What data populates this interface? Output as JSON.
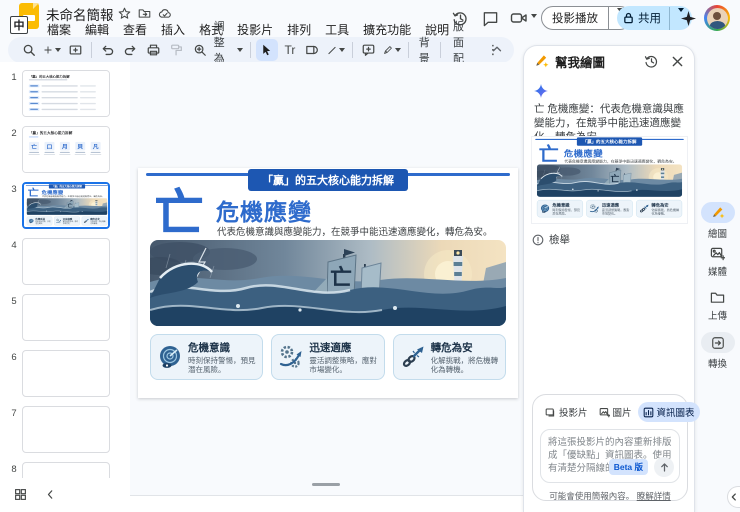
{
  "titlebar": {
    "logo_badge": "中",
    "doc_title": "未命名簡報",
    "menus": [
      "檔案",
      "編輯",
      "查看",
      "插入",
      "格式",
      "投影片",
      "排列",
      "工具",
      "擴充功能",
      "說明"
    ],
    "present_label": "投影播放",
    "share_label": "共用"
  },
  "toolbar": {
    "zoom_fit_label": "調整為符",
    "text_tool_label": "Tr",
    "background_label": "背景",
    "layout_label": "版面配置",
    "more_label": "⋮"
  },
  "filmstrip": {
    "numbers": [
      "1",
      "2",
      "3",
      "4",
      "5",
      "6",
      "7",
      "8"
    ],
    "slide1_title": "「贏」的五大核心能力拆解",
    "slide2_title": "「贏」的五大核心能力拆解",
    "slide2_chars": [
      "亡",
      "口",
      "月",
      "貝",
      "凡"
    ]
  },
  "slide": {
    "badge_title": "「贏」的五大核心能力拆解",
    "glyph": "亡",
    "heading": "危機應變",
    "subtitle": "代表危機意識與應變能力，在競爭中能迅速適應變化，轉危為安。",
    "sail_glyph": "亡",
    "cards": [
      {
        "title": "危機意識",
        "desc": "時刻保持警惕，預見潛在風險。"
      },
      {
        "title": "迅速適應",
        "desc": "靈活調整策略，應對市場變化。"
      },
      {
        "title": "轉危為安",
        "desc": "化解挑戰，將危機轉化為轉機。"
      }
    ]
  },
  "panel": {
    "title": "幫我繪圖",
    "description": "亡 危機應變：代表危機意識與應變能力，在競爭中能迅速適應變化，轉危為安。",
    "report_label": "檢舉",
    "tabs": [
      {
        "label": "投影片"
      },
      {
        "label": "圖片"
      },
      {
        "label": "資訊圖表"
      }
    ],
    "prompt_text": "將這張投影片的內容重新排版成「優缺點」資訊圖表。使用有清楚分隔線的兩...",
    "beta_label": "Beta 版",
    "footer_text": "可能會使用簡報內容。",
    "footer_link": "瞭解詳情"
  },
  "rail": {
    "items": [
      {
        "label": "繪圖"
      },
      {
        "label": "媒體"
      },
      {
        "label": "上傳"
      },
      {
        "label": "轉換"
      }
    ]
  },
  "colors": {
    "accent": "#0b57d0",
    "share_bg": "#c2e7ff",
    "selected_bg": "#d3e3fd",
    "slide_blue": "#2e6bcc",
    "badge_bg": "#1d57b2"
  }
}
